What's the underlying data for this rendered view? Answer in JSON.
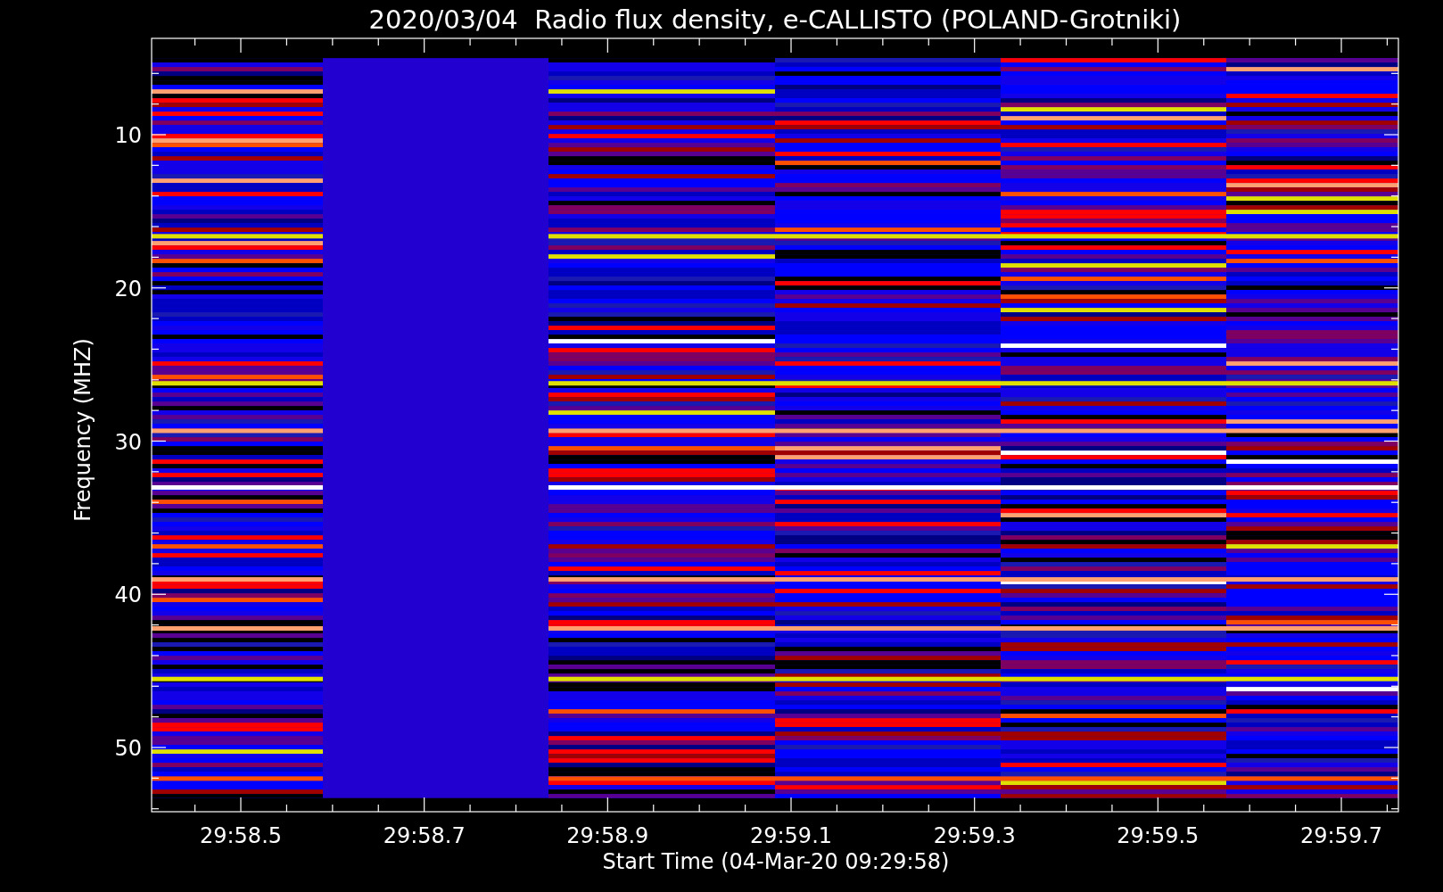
{
  "title": "2020/03/04  Radio flux density, e-CALLISTO (POLAND-Grotniki)",
  "y_axis": {
    "label": "Frequency (MHZ)",
    "ticks": [
      "10",
      "20",
      "30",
      "40",
      "50"
    ]
  },
  "x_axis": {
    "label": "Start Time (04-Mar-20 09:29:58)",
    "ticks": [
      "29:58.5",
      "29:58.7",
      "29:58.9",
      "29:59.1",
      "29:59.3",
      "29:59.5",
      "29:59.7"
    ]
  }
}
